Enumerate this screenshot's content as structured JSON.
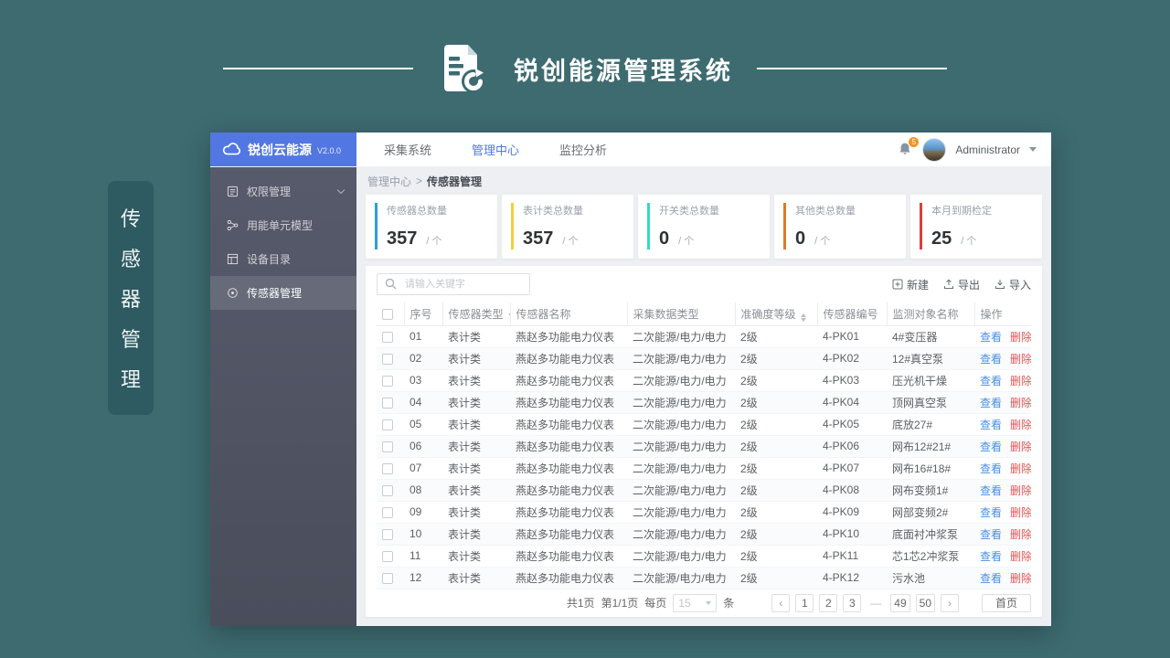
{
  "colors": {
    "teal_background": "#3d6b70",
    "tag_teal": "#2e5a61",
    "accent_blue": "#4a7be5",
    "brand_blue": "#5277e3",
    "view_link": "#4a90e2",
    "delete_link": "#e25555",
    "badge_orange": "#f39423"
  },
  "page_header": {
    "title": "锐创能源管理系统",
    "icon": "document-refresh-icon"
  },
  "side_tag": {
    "chars": [
      "传",
      "感",
      "器",
      "管",
      "理"
    ]
  },
  "app": {
    "topbar": {
      "logo_icon": "cloud-icon",
      "logo_text": "锐创云能源",
      "logo_version": "V2.0.0",
      "nav": [
        {
          "label": "采集系统",
          "active": false
        },
        {
          "label": "管理中心",
          "active": true
        },
        {
          "label": "监控分析",
          "active": false
        }
      ],
      "bell_icon": "bell-icon",
      "notification_count": "5",
      "user_name": "Administrator",
      "user_caret_icon": "caret-down-icon"
    },
    "sidebar": {
      "items": [
        {
          "label": "权限管理",
          "icon": "permission-icon",
          "chevron": true,
          "active": false
        },
        {
          "label": "用能单元模型",
          "icon": "model-icon",
          "chevron": false,
          "active": false
        },
        {
          "label": "设备目录",
          "icon": "catalog-icon",
          "chevron": false,
          "active": false
        },
        {
          "label": "传感器管理",
          "icon": "sensor-icon",
          "chevron": false,
          "active": true
        }
      ]
    },
    "breadcrumb": {
      "parent": "管理中心",
      "separator": ">",
      "current": "传感器管理"
    },
    "stats": [
      {
        "label": "传感器总数量",
        "value": "357",
        "unit": "/ 个",
        "color": "#2b9fd8"
      },
      {
        "label": "表计类总数量",
        "value": "357",
        "unit": "/ 个",
        "color": "#f0d03a"
      },
      {
        "label": "开关类总数量",
        "value": "0",
        "unit": "/ 个",
        "color": "#35d9c5"
      },
      {
        "label": "其他类总数量",
        "value": "0",
        "unit": "/ 个",
        "color": "#e0782b"
      },
      {
        "label": "本月到期检定",
        "value": "25",
        "unit": "/ 个",
        "color": "#d84040"
      }
    ],
    "toolbar": {
      "search_icon": "search-icon",
      "search_value": "",
      "search_placeholder": "请输入关键字",
      "buttons": [
        {
          "label": "新建",
          "icon": "new-icon"
        },
        {
          "label": "导出",
          "icon": "export-icon"
        },
        {
          "label": "导入",
          "icon": "import-icon"
        }
      ]
    },
    "table": {
      "headers": [
        {
          "label": "序号",
          "icon": null
        },
        {
          "label": "传感器类型",
          "icon": "filter-icon"
        },
        {
          "label": "传感器名称",
          "icon": null
        },
        {
          "label": "采集数据类型",
          "icon": null
        },
        {
          "label": "准确度等级",
          "icon": "sort-icon"
        },
        {
          "label": "传感器编号",
          "icon": null
        },
        {
          "label": "监测对象名称",
          "icon": null
        },
        {
          "label": "操作",
          "icon": null
        }
      ],
      "actions": {
        "view": "查看",
        "delete": "删除"
      },
      "rows": [
        {
          "no": "01",
          "type": "表计类",
          "name": "燕赵多功能电力仪表",
          "data_type": "二次能源/电力/电力",
          "accuracy": "2级",
          "code": "4-PK01",
          "target": "4#变压器"
        },
        {
          "no": "02",
          "type": "表计类",
          "name": "燕赵多功能电力仪表",
          "data_type": "二次能源/电力/电力",
          "accuracy": "2级",
          "code": "4-PK02",
          "target": "12#真空泵"
        },
        {
          "no": "03",
          "type": "表计类",
          "name": "燕赵多功能电力仪表",
          "data_type": "二次能源/电力/电力",
          "accuracy": "2级",
          "code": "4-PK03",
          "target": "压光机干燥"
        },
        {
          "no": "04",
          "type": "表计类",
          "name": "燕赵多功能电力仪表",
          "data_type": "二次能源/电力/电力",
          "accuracy": "2级",
          "code": "4-PK04",
          "target": "顶网真空泵"
        },
        {
          "no": "05",
          "type": "表计类",
          "name": "燕赵多功能电力仪表",
          "data_type": "二次能源/电力/电力",
          "accuracy": "2级",
          "code": "4-PK05",
          "target": "底放27#"
        },
        {
          "no": "06",
          "type": "表计类",
          "name": "燕赵多功能电力仪表",
          "data_type": "二次能源/电力/电力",
          "accuracy": "2级",
          "code": "4-PK06",
          "target": "网布12#21#"
        },
        {
          "no": "07",
          "type": "表计类",
          "name": "燕赵多功能电力仪表",
          "data_type": "二次能源/电力/电力",
          "accuracy": "2级",
          "code": "4-PK07",
          "target": "网布16#18#"
        },
        {
          "no": "08",
          "type": "表计类",
          "name": "燕赵多功能电力仪表",
          "data_type": "二次能源/电力/电力",
          "accuracy": "2级",
          "code": "4-PK08",
          "target": "网布变频1#"
        },
        {
          "no": "09",
          "type": "表计类",
          "name": "燕赵多功能电力仪表",
          "data_type": "二次能源/电力/电力",
          "accuracy": "2级",
          "code": "4-PK09",
          "target": "网部变频2#"
        },
        {
          "no": "10",
          "type": "表计类",
          "name": "燕赵多功能电力仪表",
          "data_type": "二次能源/电力/电力",
          "accuracy": "2级",
          "code": "4-PK10",
          "target": "底面衬冲浆泵"
        },
        {
          "no": "11",
          "type": "表计类",
          "name": "燕赵多功能电力仪表",
          "data_type": "二次能源/电力/电力",
          "accuracy": "2级",
          "code": "4-PK11",
          "target": "芯1芯2冲浆泵"
        },
        {
          "no": "12",
          "type": "表计类",
          "name": "燕赵多功能电力仪表",
          "data_type": "二次能源/电力/电力",
          "accuracy": "2级",
          "code": "4-PK12",
          "target": "污水池"
        }
      ]
    },
    "pagination": {
      "summary_total": "共1页",
      "summary_current": "第1/1页",
      "per_page_prefix": "每页",
      "per_page_value": "15",
      "per_page_suffix": "条",
      "prev_icon": "‹",
      "next_icon": "›",
      "pages": [
        "1",
        "2",
        "3",
        "—",
        "49",
        "50"
      ],
      "home_label": "首页"
    }
  }
}
